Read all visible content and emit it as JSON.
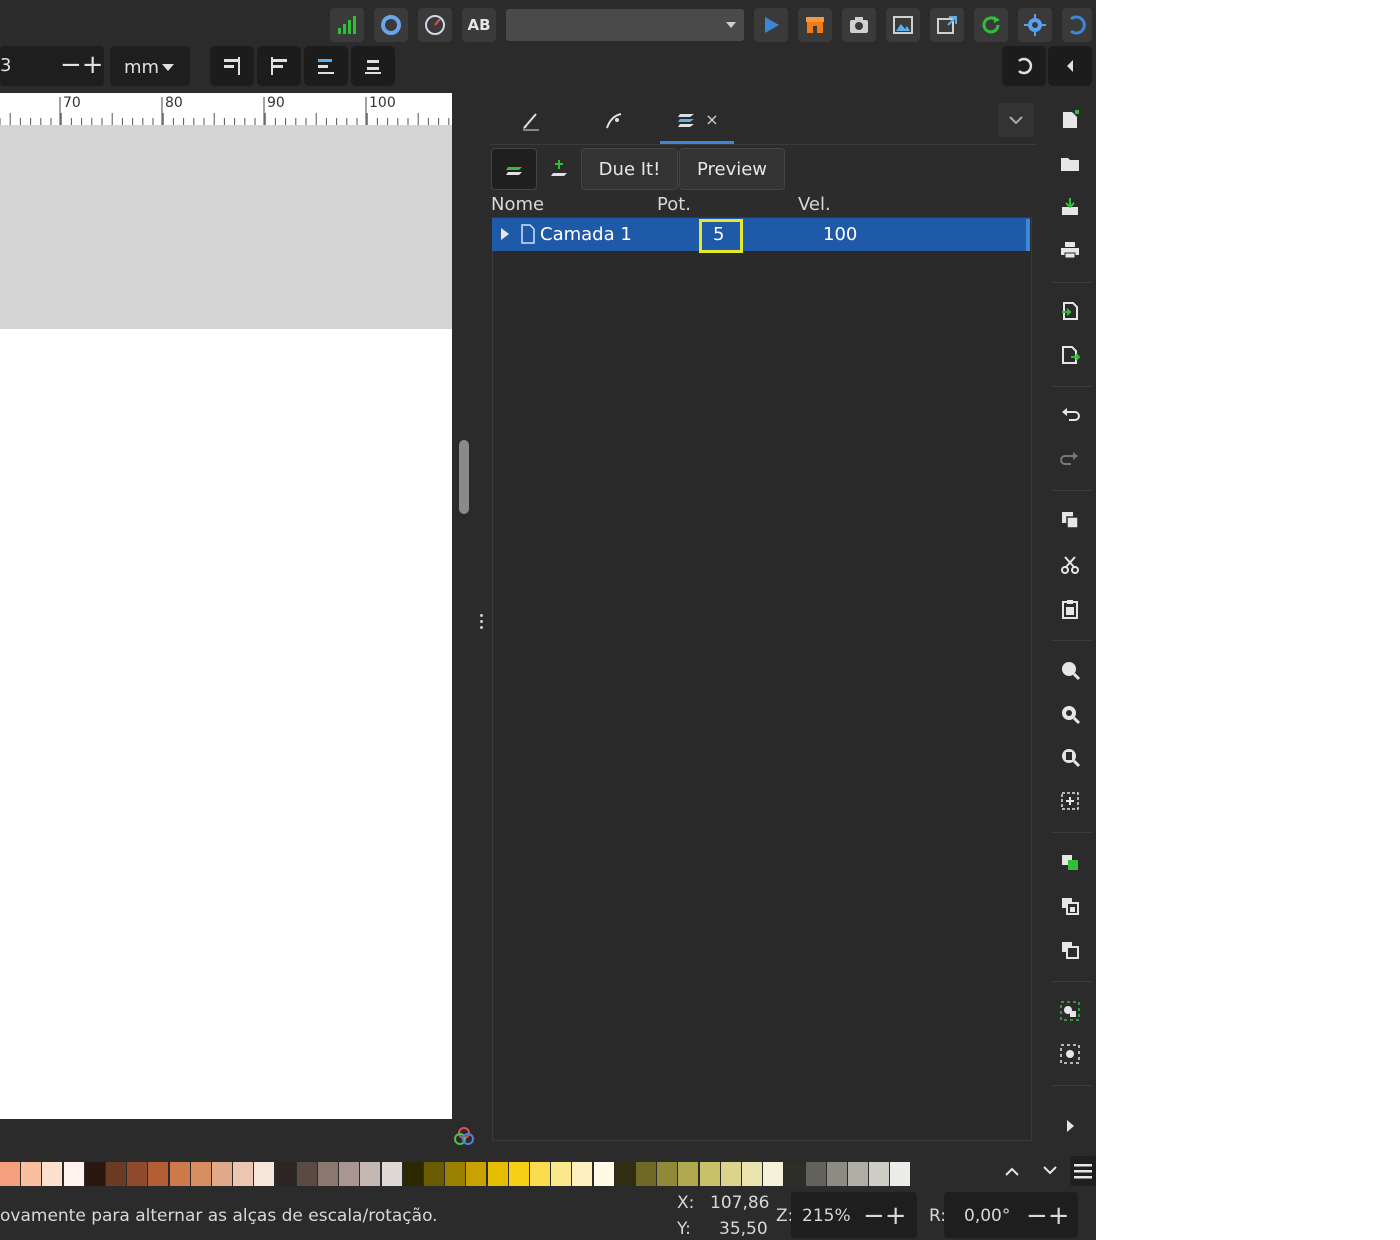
{
  "toolbar2": {
    "field_value": "3",
    "unit": "mm"
  },
  "ruler": {
    "ticks": [
      "70",
      "80",
      "90",
      "100"
    ]
  },
  "dock": {
    "buttons": {
      "due_it": "Due It!",
      "preview": "Preview"
    },
    "columns": {
      "name": "Nome",
      "pot": "Pot.",
      "vel": "Vel."
    },
    "layer": {
      "name": "Camada 1",
      "pot": "5",
      "vel": "100"
    },
    "tab_close": "×"
  },
  "topbar": {
    "ab_label": "AB"
  },
  "status": {
    "message": "ovamente para alternar as alças de escala/rotação.",
    "x_label": "X:",
    "x_value": "107,86",
    "y_label": "Y:",
    "y_value": "35,50",
    "zoom_label": "Z:",
    "zoom_value": "215%",
    "rotation_label": "R:",
    "rotation_value": "0,00°"
  },
  "palette": {
    "colors": [
      "#f4a07c",
      "#f9bf9f",
      "#fde1cf",
      "#fff3eb",
      "#2a1710",
      "#6b3a24",
      "#8e4a2c",
      "#b35e35",
      "#cc7a4a",
      "#d98e61",
      "#e0a98a",
      "#ecc6b0",
      "#f6e5da",
      "#2c2523",
      "#5a4a44",
      "#8a7770",
      "#a89690",
      "#c5b8b3",
      "#e0d8d5",
      "#2c2800",
      "#6a5a00",
      "#9a8000",
      "#c9a100",
      "#e6bd00",
      "#f6cf16",
      "#f9dd4e",
      "#fbe88a",
      "#fdf2bf",
      "#fffae6",
      "#302d10",
      "#6e6a26",
      "#8f8a3a",
      "#b0a84f",
      "#c9c06a",
      "#dcd48c",
      "#ebe4b1",
      "#f6f2d9",
      "#2e2e28",
      "#63625a",
      "#8d8c83",
      "#b0afa6",
      "#cfcec6",
      "#ececea"
    ]
  },
  "colors": {
    "accent": "#3d86d6",
    "selected_row": "#1f5aa8",
    "highlight_box": "#e5e82a",
    "panel_bg": "#2c2c2c"
  }
}
